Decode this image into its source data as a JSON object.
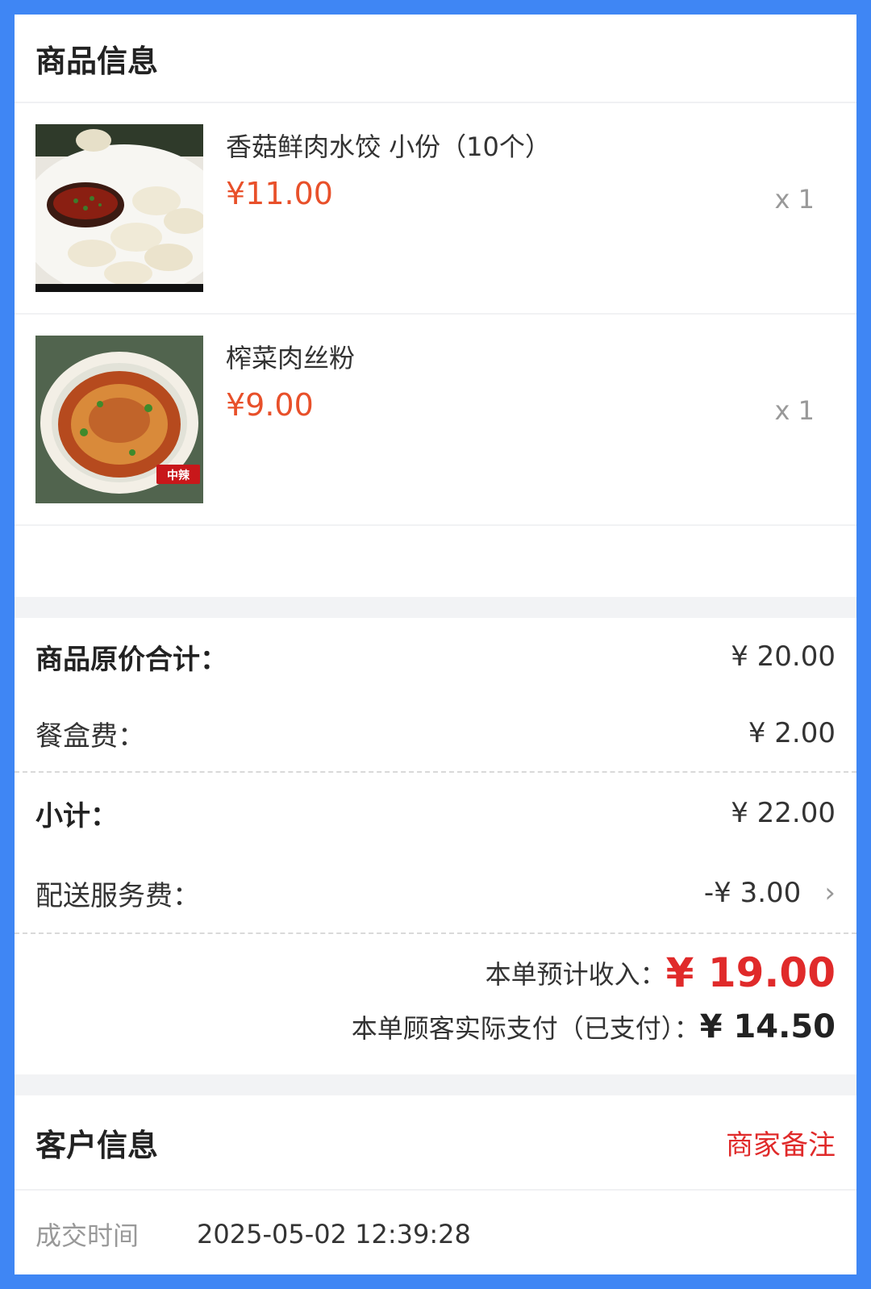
{
  "goods": {
    "section_title": "商品信息",
    "items": [
      {
        "name": "香菇鲜肉水饺 小份（10个）",
        "price": "¥11.00",
        "qty": "x 1"
      },
      {
        "name": "榨菜肉丝粉",
        "price": "¥9.00",
        "qty": "x 1"
      }
    ]
  },
  "summary": {
    "original_total_label": "商品原价合计：",
    "original_total_value": "¥ 20.00",
    "box_fee_label": "餐盒费：",
    "box_fee_value": "¥ 2.00",
    "subtotal_label": "小计：",
    "subtotal_value": "¥ 22.00",
    "delivery_fee_label": "配送服务费：",
    "delivery_fee_value": "-¥ 3.00",
    "income_label": "本单预计收入：",
    "income_value": "¥ 19.00",
    "paid_label": "本单顾客实际支付（已支付）：",
    "paid_value": "¥ 14.50"
  },
  "customer": {
    "section_title": "客户信息",
    "merchant_note": "商家备注",
    "deal_time_label": "成交时间",
    "deal_time_value": "2025-05-02 12:39:28"
  }
}
